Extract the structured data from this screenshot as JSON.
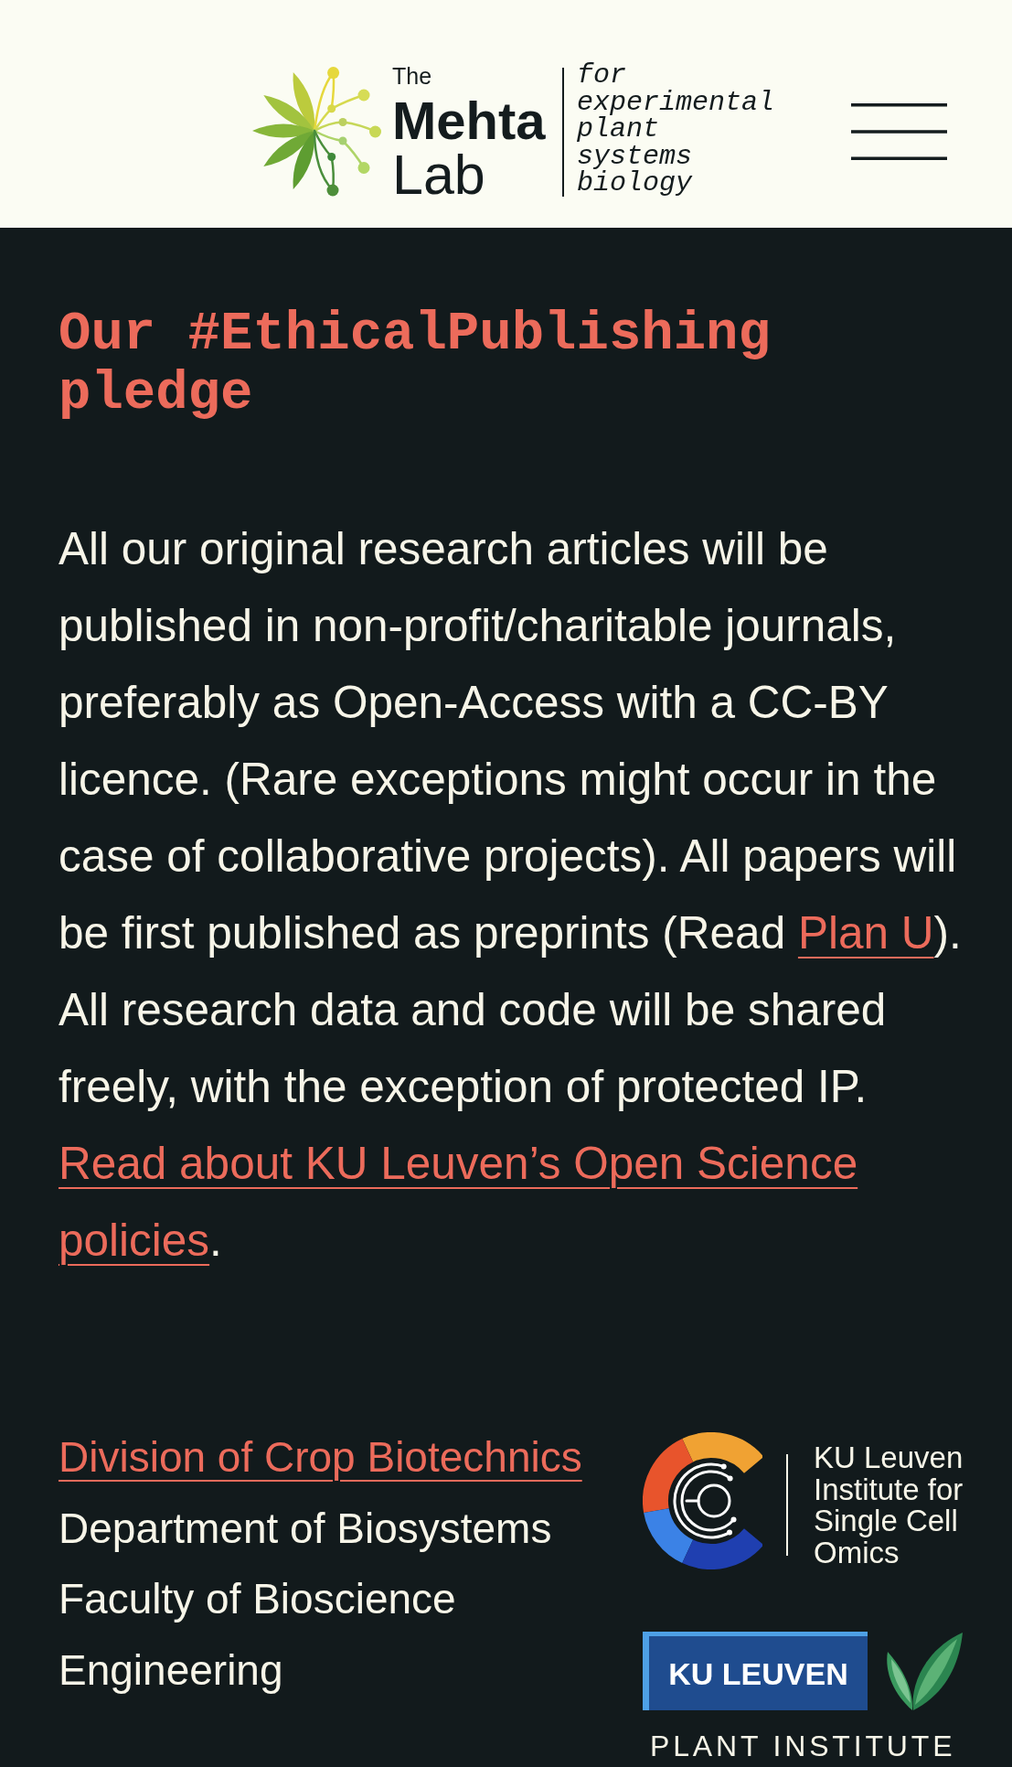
{
  "header": {
    "logo": {
      "lines": [
        {
          "kind": "small",
          "text": "The"
        },
        {
          "kind": "bold",
          "text": "Mehta"
        },
        {
          "kind": "light",
          "text": "Lab"
        }
      ],
      "tagline": "for experimental plant systems biology"
    }
  },
  "pledge": {
    "heading": "Our #EthicalPublishing pledge",
    "paragraph": [
      {
        "kind": "text",
        "text": "All our original research articles will be published in non-profit/charitable journals, preferably as Open-Access with a CC-BY licence. (Rare exceptions might occur in the case of collaborative projects). All papers will be first published as preprints (Read "
      },
      {
        "kind": "link",
        "text": "Plan U"
      },
      {
        "kind": "text",
        "text": "). All research data and code will be shared freely, with the exception of protected IP. "
      },
      {
        "kind": "link",
        "text": "Read about KU Leuven’s Open Science policies"
      },
      {
        "kind": "text",
        "text": "."
      }
    ]
  },
  "footer": {
    "affiliations": [
      {
        "kind": "link",
        "text": "Division of Crop Biotechnics"
      },
      {
        "kind": "text",
        "text": "Department of Biosystems"
      },
      {
        "kind": "text",
        "text": "Faculty of Bioscience Engineering"
      }
    ],
    "partner_logos": [
      {
        "kind": "institute",
        "name": "KU Leuven Institute for Single Cell Omics"
      },
      {
        "kind": "plant_institute",
        "wordmark": "KU LEUVEN",
        "subtitle": "PLANT INSTITUTE"
      }
    ]
  }
}
